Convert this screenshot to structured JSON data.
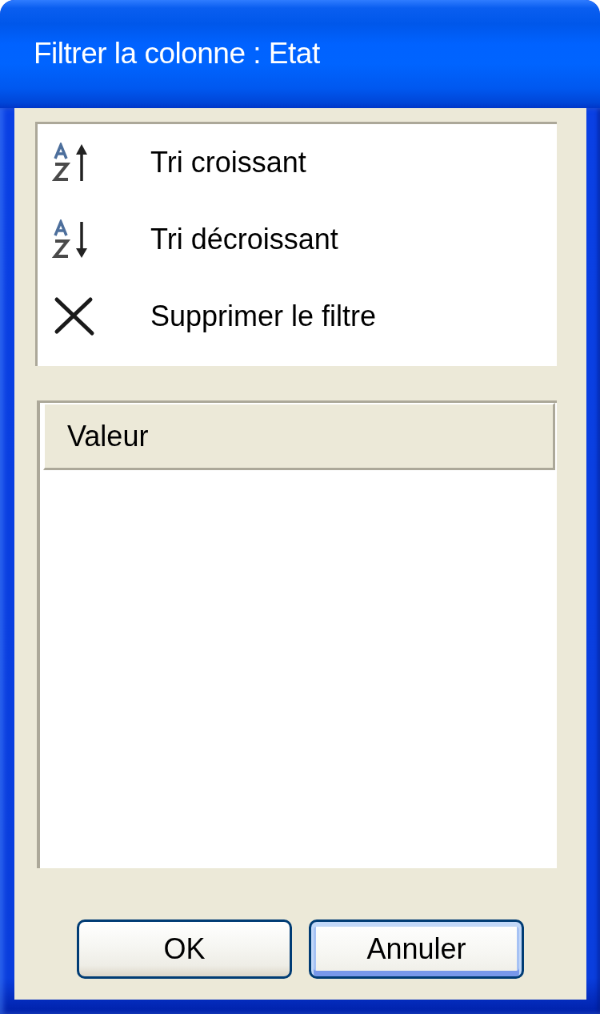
{
  "window": {
    "title": "Filtrer la colonne : Etat"
  },
  "menu": [
    {
      "kind": "ascending",
      "label": "Tri croissant"
    },
    {
      "kind": "descending",
      "label": "Tri décroissant"
    },
    {
      "kind": "remove",
      "label": "Supprimer le filtre"
    }
  ],
  "list": {
    "columns": [
      {
        "label": "Valeur"
      }
    ]
  },
  "buttons": [
    {
      "label": "OK",
      "default": false
    },
    {
      "label": "Annuler",
      "default": true
    }
  ]
}
